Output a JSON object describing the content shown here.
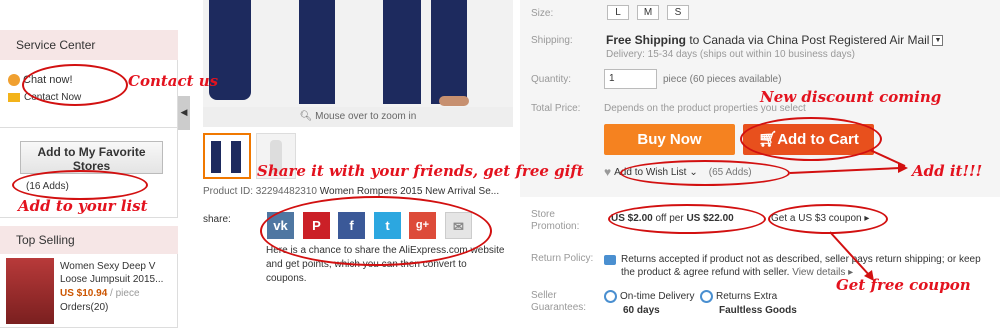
{
  "sidebar": {
    "service_center_title": "Service Center",
    "chat_now": "Chat now!",
    "contact_now": "Contact Now",
    "favorite_button": "Add to My Favorite Stores",
    "favorite_count": "(16 Adds)",
    "top_selling_title": "Top Selling",
    "top_item": {
      "title": "Women Sexy Deep V Loose Jumpsuit 2015...",
      "price": "US $10.94",
      "unit": " / piece",
      "orders": "Orders(20)"
    }
  },
  "gallery": {
    "zoom_hint": "Mouse over to zoom in",
    "product_id": "Product ID: 32294482310",
    "product_name": "Women Rompers 2015 New Arrival Se..."
  },
  "share": {
    "label": "share:",
    "icons": [
      "vk-icon",
      "pinterest-icon",
      "facebook-icon",
      "twitter-icon",
      "google-plus-icon",
      "mail-icon"
    ],
    "vk": "vk",
    "pin": "P",
    "fb": "f",
    "tw": "t",
    "gp": "g+",
    "mail": "✉",
    "text": "Here is a chance to share the AliExpress.com website and get points, which you can then convert to coupons."
  },
  "details": {
    "size_label": "Size:",
    "sizes": [
      "L",
      "M",
      "S"
    ],
    "shipping_label": "Shipping:",
    "shipping_bold": "Free Shipping",
    "shipping_rest": " to Canada via China Post Registered Air Mail",
    "delivery": "Delivery: 15-34 days (ships out within 10 business days)",
    "quantity_label": "Quantity:",
    "quantity_value": "1",
    "quantity_note": "piece (60 pieces available)",
    "total_label": "Total Price:",
    "total_value": "Depends on the product properties you select",
    "buy_now": "Buy Now",
    "add_to_cart": "Add to Cart",
    "wish_list": "Add to Wish List",
    "wish_count": "(65 Adds)",
    "store_promo_label": "Store Promotion:",
    "promo_discount_a": "US $2.00",
    "promo_discount_b": " off per ",
    "promo_discount_c": "US $22.00",
    "promo_coupon": "Get a US $3 coupon ▸",
    "return_label": "Return Policy:",
    "return_text": "Returns accepted if product not as described, seller pays return shipping; or keep the product & agree refund with seller.",
    "view_details": " View details ▸",
    "guarantee_label": "Seller Guarantees:",
    "g1_title": "On-time Delivery",
    "g1_value": "60 days",
    "g2_title": "Returns Extra",
    "g2_value": "Faultless Goods"
  },
  "annotations": {
    "contact_us": "Contact us",
    "add_to_list": "Add to your list",
    "share_gift": "Share it with your friends, get free gift",
    "new_discount": "New discount coming",
    "add_it": "Add it!!!",
    "free_coupon": "Get free coupon"
  },
  "colors": {
    "buy_now": "#f58220",
    "add_to_cart": "#e8501d",
    "annotation": "#e3121e",
    "sidebar_header": "#f6e6e6"
  }
}
